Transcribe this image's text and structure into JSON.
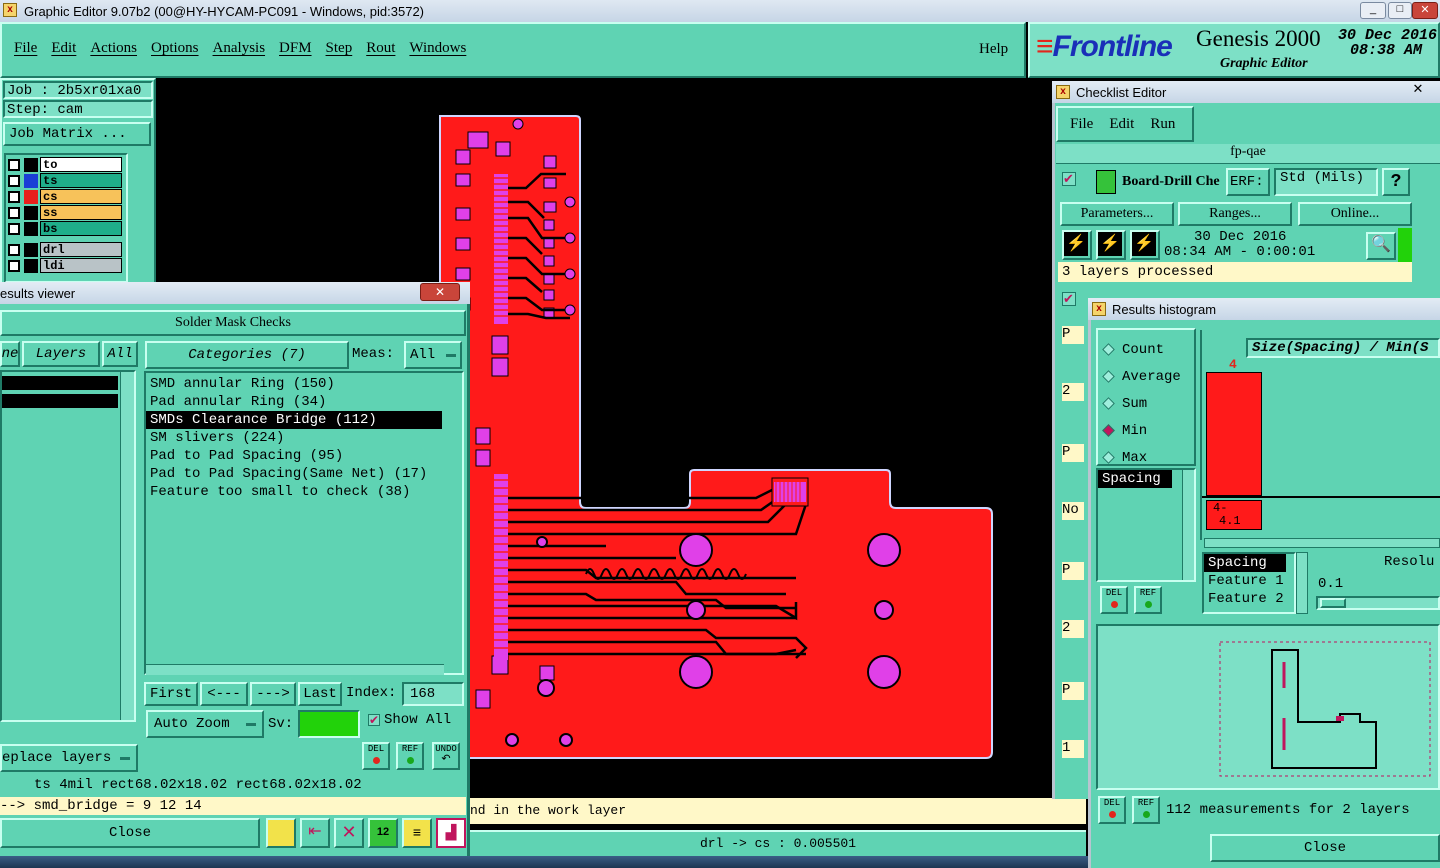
{
  "window": {
    "title": "Graphic Editor 9.07b2 (00@HY-HYCAM-PC091 - Windows, pid:3572)"
  },
  "menu": {
    "items": [
      "File",
      "Edit",
      "Actions",
      "Options",
      "Analysis",
      "DFM",
      "Step",
      "Rout",
      "Windows"
    ],
    "help": "Help"
  },
  "brand": {
    "logo": "Frontline",
    "product": "Genesis 2000",
    "subtitle": "Graphic Editor",
    "date": "30 Dec 2016",
    "time": "08:38 AM"
  },
  "job": {
    "job_label": "Job : 2b5xr01xa0",
    "step_label": "Step: cam",
    "matrix_button": "Job Matrix ..."
  },
  "layers": [
    {
      "name": "to",
      "color": "#000000",
      "bg": "#ffffff"
    },
    {
      "name": "ts",
      "color": "#1a3fd6",
      "bg": "#1fae8a"
    },
    {
      "name": "cs",
      "color": "#e8201c",
      "bg": "#f7c25a"
    },
    {
      "name": "ss",
      "color": "#000000",
      "bg": "#f7c25a"
    },
    {
      "name": "bs",
      "color": "#000000",
      "bg": "#1fae8a"
    },
    {
      "name": "drl",
      "color": "#000000",
      "bg": "#b9c3c7"
    },
    {
      "name": "ldi",
      "color": "#000000",
      "bg": "#b9c3c7"
    }
  ],
  "results_viewer": {
    "title": "esults viewer",
    "header": "Solder Mask Checks",
    "layers_tab": "Layers",
    "all_tab": "All",
    "left_tab": "ne",
    "categories_title": "Categories (7)",
    "meas_label": "Meas:",
    "meas_value": "All",
    "categories": [
      "SMD annular Ring (150)",
      "Pad annular Ring (34)",
      "SMDs Clearance Bridge (112)",
      "SM slivers (224)",
      "Pad to Pad Spacing (95)",
      "Pad to Pad Spacing(Same Net) (17)",
      "Feature too small to check (38)"
    ],
    "selected_category_index": 2,
    "nav": {
      "first": "First",
      "prev": "<---",
      "next": "--->",
      "last": "Last",
      "index_label": "Index:",
      "index_value": "168"
    },
    "auto_zoom": "Auto Zoom",
    "sv_label": "Sv:",
    "show_all": "Show All",
    "replace_layers": "eplace layers",
    "info_line": "ts 4mil   rect68.02x18.02   rect68.02x18.02",
    "bridge_line": "--> smd_bridge = 9 12 14",
    "close": "Close",
    "icons": {
      "del": "DEL",
      "ref": "REF",
      "undo": "UNDO"
    }
  },
  "status": {
    "message": "nd in the work layer",
    "measure": "drl -> cs : 0.005501"
  },
  "checklist": {
    "title": "Checklist Editor",
    "menu": [
      "File",
      "Edit",
      "Run"
    ],
    "name": "fp-qae",
    "action_label": "Board-Drill Che",
    "erf_label": "ERF:",
    "erf_value": "Std (Mils)",
    "help": "?",
    "buttons": [
      "Parameters...",
      "Ranges...",
      "Online..."
    ],
    "run_date": "30 Dec 2016",
    "run_time": "08:34 AM - 0:00:01",
    "status": "3 layers processed",
    "side_letters": [
      "P",
      "2",
      "P",
      "No",
      "P",
      "2",
      "P",
      "1"
    ]
  },
  "histogram": {
    "title": "Results histogram",
    "modes": [
      "Count",
      "Average",
      "Sum",
      "Min",
      "Max"
    ],
    "selected_mode": "Min",
    "measures": [
      "Spacing"
    ],
    "chart_title": "Size(Spacing) / Min(S",
    "bar_value": "4",
    "bar_label": "4-",
    "bar_label2": "4.1",
    "fields": [
      "Spacing",
      "Feature 1",
      "Feature 2"
    ],
    "resolution_label": "Resolu",
    "resolution_value": "0.1",
    "summary": "112 measurements for 2 layers",
    "close": "Close",
    "del": "DEL",
    "ref": "REF"
  },
  "colors": {
    "panel": "#5fd3b3",
    "board": "#ff1a1a",
    "pad": "#e040e8",
    "canvas": "#000000"
  }
}
